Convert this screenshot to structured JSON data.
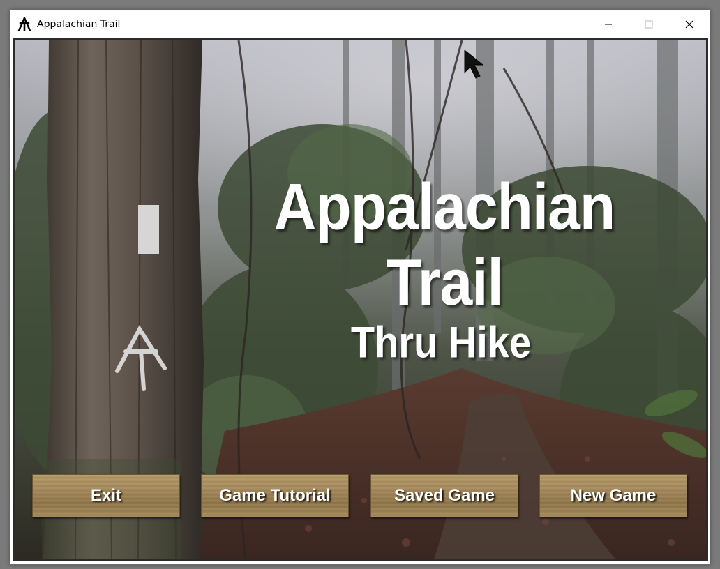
{
  "window": {
    "title": "Appalachian Trail",
    "controls": [
      "minimize-icon",
      "maximize-icon",
      "close-icon"
    ]
  },
  "game": {
    "title": "Appalachian Trail",
    "subtitle": "Thru Hike",
    "buttons": [
      {
        "label": "Exit"
      },
      {
        "label": "Game Tutorial"
      },
      {
        "label": "Saved Game"
      },
      {
        "label": "New Game"
      }
    ]
  },
  "colors": {
    "button_wood": "#a2875a",
    "title_text": "#ffffff",
    "blaze": "#ffffff"
  }
}
